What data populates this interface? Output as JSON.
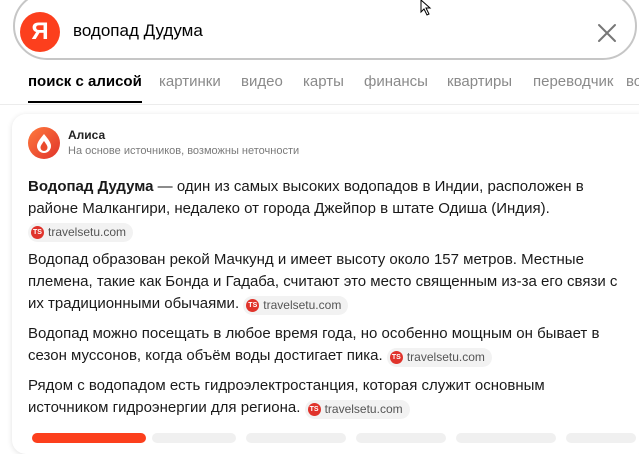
{
  "search": {
    "logo_letter": "Я",
    "query": "водопад Дудума"
  },
  "tabs": [
    {
      "label": "поиск с алисой",
      "active": true
    },
    {
      "label": "картинки"
    },
    {
      "label": "видео"
    },
    {
      "label": "карты"
    },
    {
      "label": "финансы"
    },
    {
      "label": "квартиры"
    },
    {
      "label": "переводчик"
    },
    {
      "label": "во"
    }
  ],
  "alice": {
    "name": "Алиса",
    "note": "На основе источников, возможны неточности"
  },
  "answer": {
    "p1_bold": "Водопад Дудума",
    "p1_text": " — один из самых высоких водопадов в Индии, расположен в районе Малкангири, недалеко от города Джейпор в штате Одиша (Индия).",
    "p2_text": "Водопад образован рекой Мачкунд и имеет высоту около 157 метров. Местные племена, такие как Бонда и Гадаба, считают это место священным из-за его связи с их традиционными обычаями.",
    "p3_text": "Водопад можно посещать в любое время года, но особенно мощным он бывает в сезон муссонов, когда объём воды достигает пика.",
    "p4_text": "Рядом с водопадом есть гидроэлектростанция, которая служит основным источником гидроэнергии для региона."
  },
  "source": {
    "domain": "travelsetu.com",
    "icon_text": "TS"
  },
  "colors": {
    "yandex_red": "#fc3f1d",
    "alice_gradient_start": "#ff6a3d",
    "alice_gradient_end": "#e0332b"
  }
}
